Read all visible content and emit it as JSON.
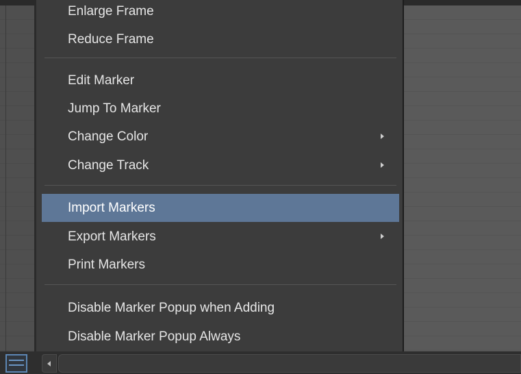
{
  "menu": {
    "items": [
      {
        "label": "Enlarge Frame",
        "submenu": false,
        "highlighted": false
      },
      {
        "label": "Reduce Frame",
        "submenu": false,
        "highlighted": false
      },
      {
        "label": "Edit Marker",
        "submenu": false,
        "highlighted": false
      },
      {
        "label": "Jump To Marker",
        "submenu": false,
        "highlighted": false
      },
      {
        "label": "Change Color",
        "submenu": true,
        "highlighted": false
      },
      {
        "label": "Change Track",
        "submenu": true,
        "highlighted": false
      },
      {
        "label": "Import Markers",
        "submenu": false,
        "highlighted": true
      },
      {
        "label": "Export Markers",
        "submenu": true,
        "highlighted": false
      },
      {
        "label": "Print Markers",
        "submenu": false,
        "highlighted": false
      },
      {
        "label": "Disable Marker Popup when Adding",
        "submenu": false,
        "highlighted": false
      },
      {
        "label": "Disable Marker Popup Always",
        "submenu": false,
        "highlighted": false
      }
    ]
  },
  "icons": {
    "view_toggle": "list-view-icon",
    "submenu_arrow": "chevron-right-icon",
    "scroll_left": "scroll-left-arrow-icon"
  },
  "colors": {
    "menu_background": "#3c3c3c",
    "highlight": "#5e7797",
    "accent": "#5c86b4"
  }
}
